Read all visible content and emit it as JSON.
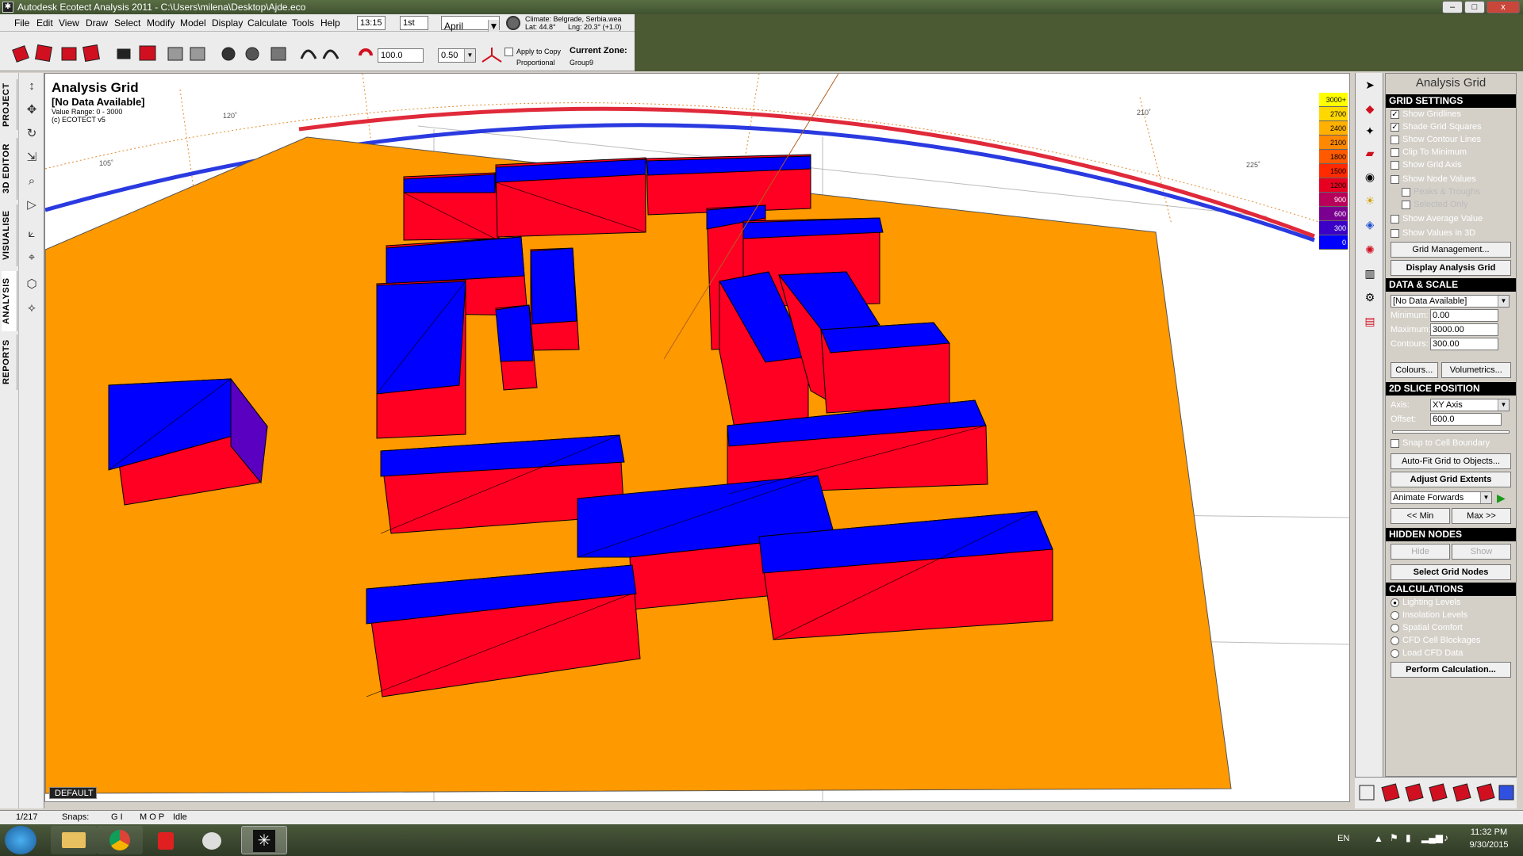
{
  "window": {
    "title": "Autodesk Ecotect Analysis 2011 - C:\\Users\\milena\\Desktop\\Ajde.eco",
    "min": "–",
    "max": "□",
    "close": "x"
  },
  "menu": [
    "File",
    "Edit",
    "View",
    "Draw",
    "Select",
    "Modify",
    "Model",
    "Display",
    "Calculate",
    "Tools",
    "Help"
  ],
  "toolbar": {
    "time": "13:15",
    "day": "1st",
    "month": "April",
    "climate": "Climate: Belgrade, Serbia.wea",
    "lat": "Lat: 44.8°",
    "lng": "Lng: 20.3° (+1.0)",
    "scale_value": "100.0",
    "offset_value": "0.50",
    "apply_to_copy": "Apply to Copy",
    "proportional": "Proportional",
    "current_zone_label": "Current Zone:",
    "current_zone": "Group9"
  },
  "left_tabs": [
    "PROJECT",
    "3D EDITOR",
    "VISUALISE",
    "ANALYSIS",
    "REPORTS"
  ],
  "viewport": {
    "title": "Analysis Grid",
    "subtitle": "[No Data Available]",
    "value_range": "Value Range: 0 - 3000",
    "copyright": "(c) ECOTECT v5",
    "compass_labels": [
      "105˚",
      "120˚",
      "210˚",
      "225˚"
    ],
    "default_tab": "DEFAULT"
  },
  "legend": [
    {
      "label": "3000+",
      "color": "#ffff00"
    },
    {
      "label": "2700",
      "color": "#ffd800"
    },
    {
      "label": "2400",
      "color": "#ffb000"
    },
    {
      "label": "2100",
      "color": "#ff8800"
    },
    {
      "label": "1800",
      "color": "#ff5a00"
    },
    {
      "label": "1500",
      "color": "#ff2a00"
    },
    {
      "label": "1200",
      "color": "#e80020"
    },
    {
      "label": "900",
      "color": "#b8005a"
    },
    {
      "label": "600",
      "color": "#7a0090"
    },
    {
      "label": "300",
      "color": "#3a00c8"
    },
    {
      "label": "0",
      "color": "#0000ff"
    }
  ],
  "panel": {
    "title": "Analysis Grid",
    "grid_settings": {
      "header": "GRID SETTINGS",
      "items": [
        {
          "label": "Show Gridlines",
          "checked": true
        },
        {
          "label": "Shade Grid Squares",
          "checked": true
        },
        {
          "label": "Show Contour Lines",
          "checked": false
        },
        {
          "label": "Clip To Minimum",
          "checked": false
        },
        {
          "label": "Show Grid Axis",
          "checked": false
        }
      ],
      "node_values": "Show Node Values",
      "peaks": "Peaks & Troughs",
      "selected_only": "Selected Only",
      "avg": "Show Average Value",
      "values3d": "Show Values in 3D",
      "grid_mgmt": "Grid Management...",
      "display_grid": "Display Analysis Grid"
    },
    "data_scale": {
      "header": "DATA & SCALE",
      "data_select": "[No Data Available]",
      "min_label": "Minimum:",
      "min": "0.00",
      "max_label": "Maximum:",
      "max": "3000.00",
      "contours_label": "Contours:",
      "contours": "300.00",
      "colours": "Colours...",
      "volumetrics": "Volumetrics..."
    },
    "slice": {
      "header": "2D SLICE POSITION",
      "axis_label": "Axis:",
      "axis": "XY Axis",
      "offset_label": "Offset:",
      "offset": "600.0",
      "snap": "Snap to Cell Boundary",
      "autofit": "Auto-Fit Grid to Objects...",
      "adjust": "Adjust Grid Extents",
      "animate": "Animate Forwards",
      "min_btn": "<< Min",
      "max_btn": "Max >>"
    },
    "hidden": {
      "header": "HIDDEN NODES",
      "hide": "Hide",
      "show": "Show",
      "select": "Select Grid Nodes"
    },
    "calc": {
      "header": "CALCULATIONS",
      "options": [
        {
          "label": "Lighting Levels",
          "selected": true
        },
        {
          "label": "Insolation Levels",
          "selected": false
        },
        {
          "label": "Spatial Comfort",
          "selected": false
        },
        {
          "label": "CFD Cell Blockages",
          "selected": false
        },
        {
          "label": "Load CFD Data",
          "selected": false
        }
      ],
      "perform": "Perform Calculation..."
    }
  },
  "status": {
    "count": "1/217",
    "snaps": "Snaps:",
    "g": "G I",
    "mop": "M O P",
    "state": "Idle"
  },
  "tray": {
    "lang": "EN",
    "time": "11:32 PM",
    "date": "9/30/2015"
  }
}
